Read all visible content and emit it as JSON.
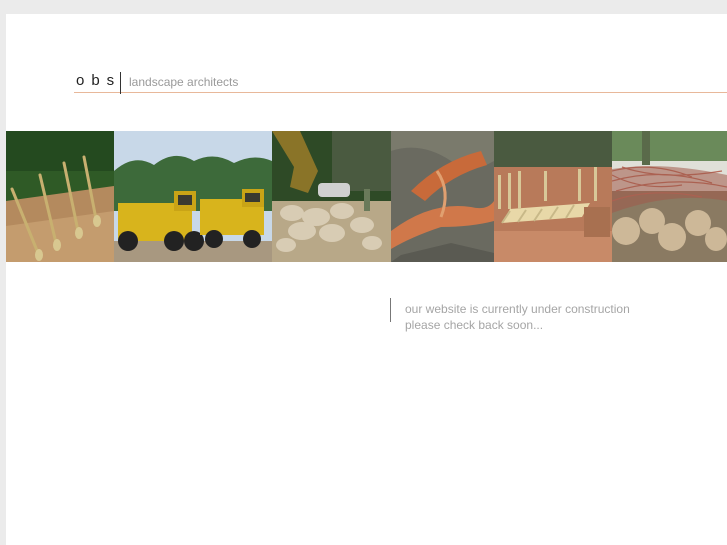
{
  "header": {
    "logo": "obs",
    "tagline": "landscape architects"
  },
  "photos": [
    {
      "name": "shovels-photo"
    },
    {
      "name": "dump-trucks-photo"
    },
    {
      "name": "excavator-boulders-photo"
    },
    {
      "name": "aerial-site-photo"
    },
    {
      "name": "wood-framing-photo"
    },
    {
      "name": "tree-rootballs-photo"
    }
  ],
  "message": {
    "line1": "our website is currently under construction",
    "line2": "please check back soon..."
  },
  "colors": {
    "background": "#ebebeb",
    "page": "#ffffff",
    "accent_line": "#e8b89a",
    "message_text": "#a5a5a5"
  }
}
